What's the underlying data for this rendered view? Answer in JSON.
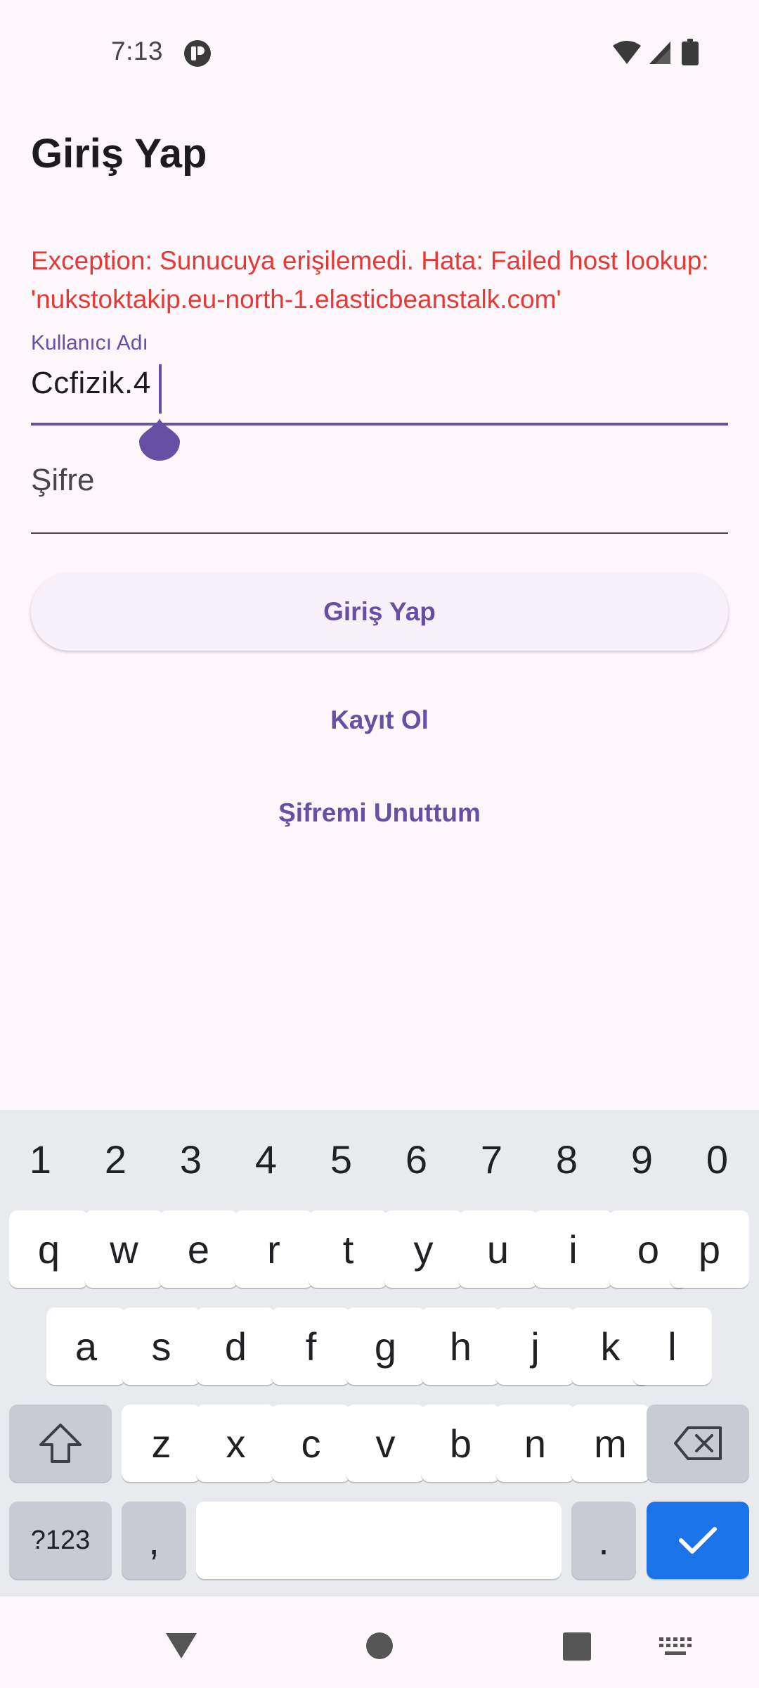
{
  "status_bar": {
    "time": "7:13"
  },
  "login": {
    "title": "Giriş Yap",
    "error_message": "Exception: Sunucuya erişilemedi. Hata: Failed host lookup: 'nukstoktakip.eu-north-1.elasticbeanstalk.com'",
    "username_label": "Kullanıcı Adı",
    "username_value": "Ccfizik.4",
    "password_label": "Şifre",
    "login_button": "Giriş Yap",
    "register_button": "Kayıt Ol",
    "forgot_password_button": "Şifremi Unuttum"
  },
  "keyboard": {
    "number_row": [
      "1",
      "2",
      "3",
      "4",
      "5",
      "6",
      "7",
      "8",
      "9",
      "0"
    ],
    "row1": [
      "q",
      "w",
      "e",
      "r",
      "t",
      "y",
      "u",
      "i",
      "o",
      "p"
    ],
    "row2": [
      "a",
      "s",
      "d",
      "f",
      "g",
      "h",
      "j",
      "k",
      "l"
    ],
    "row3": [
      "z",
      "x",
      "c",
      "v",
      "b",
      "n",
      "m"
    ],
    "symbols_key": "?123",
    "comma_key": ",",
    "period_key": "."
  },
  "colors": {
    "accent": "#6750a4",
    "error": "#e53935",
    "background": "#fdf7fc",
    "enter_key": "#1a73e8"
  },
  "icons": {
    "status": [
      "app-notification-icon",
      "wifi-icon",
      "signal-icon",
      "battery-icon"
    ],
    "keyboard": [
      "shift-icon",
      "backspace-icon",
      "checkmark-icon"
    ],
    "navigation": [
      "back-icon",
      "home-icon",
      "recents-icon",
      "keyboard-switch-icon"
    ]
  }
}
